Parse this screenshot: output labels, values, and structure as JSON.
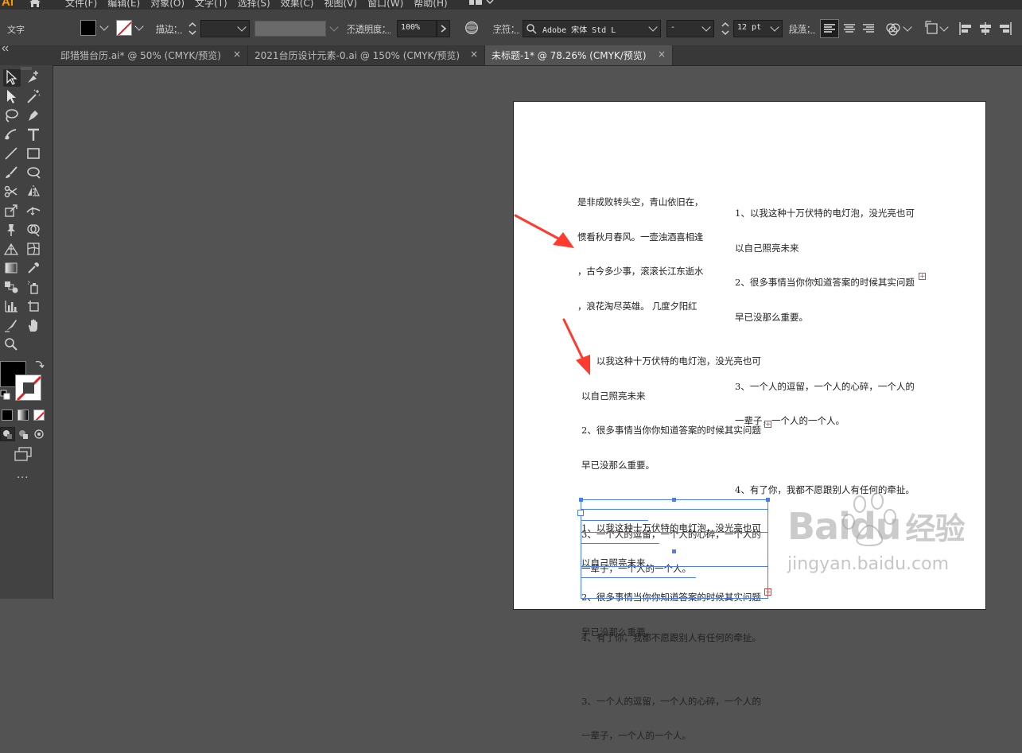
{
  "app": {
    "logo": "Ai"
  },
  "menu": [
    "文件(F)",
    "编辑(E)",
    "对象(O)",
    "文字(T)",
    "选择(S)",
    "效果(C)",
    "视图(V)",
    "窗口(W)",
    "帮助(H)"
  ],
  "control_bar": {
    "mode_label": "文字",
    "stroke_label": "描边：",
    "opacity_label": "不透明度：",
    "opacity_value": "100%",
    "char_label": "字符：",
    "font_name": "Adobe 宋体 Std L",
    "font_style": "-",
    "font_size": "12 pt",
    "para_label": "段落："
  },
  "tabs": [
    {
      "label": "邱猎猎台历.ai* @ 50% (CMYK/预览)",
      "close": "×"
    },
    {
      "label": "2021台历设计元素-0.ai @ 150% (CMYK/预览)",
      "close": "×"
    },
    {
      "label": "未标题-1* @ 78.26% (CMYK/预览)",
      "close": "×"
    }
  ],
  "toolbox": {
    "more": "..."
  },
  "artboard": {
    "poem_block": {
      "lines": [
        "是非成败转头空，青山依旧在，",
        "惯看秋月春风。一壶浊酒喜相逢",
        "，古今多少事，滚滚长江东逝水",
        "，浪花淘尽英雄。 几度夕阳红"
      ]
    },
    "list_block": {
      "lines": [
        "1、以我这种十万伏特的电灯泡，没光亮也可",
        "以自己照亮未来",
        "2、很多事情当你你知道答案的时候其实问题",
        "早已没那么重要。",
        "",
        "3、一个人的逗留，一个人的心碎，一个人的",
        "一辈子，一个人的一个人。",
        "",
        "4、有了你，我都不愿跟别人有任何的牵扯。"
      ]
    },
    "overflow_mark": "+"
  },
  "watermark": {
    "brand": "Baidu",
    "suffix": "经验",
    "url": "jingyan.baidu.com"
  },
  "colors": {
    "accent_selection": "#4a7ef0",
    "arrow": "#ff3b2f",
    "logo": "#ff9a00",
    "overflow": "#e04040"
  }
}
